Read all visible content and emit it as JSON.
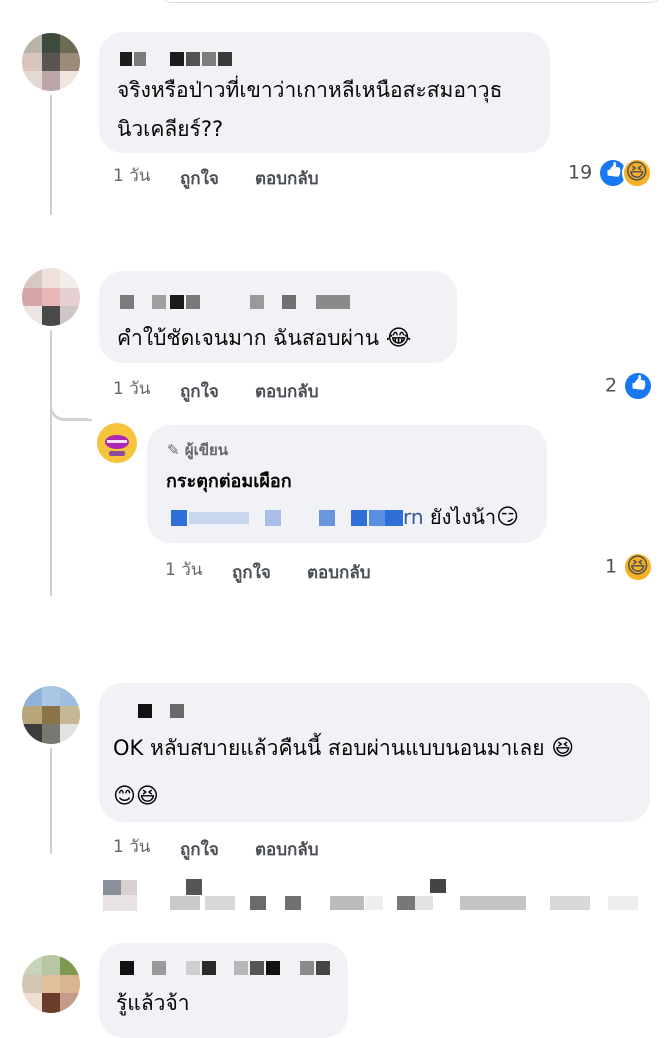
{
  "comments": [
    {
      "text_line1": "จริงหรือป่าวที่เขาว่าเกาหลีเหนือสะสมอาวุธ",
      "text_line2": "นิวเคลียร์??",
      "time": "1 วัน",
      "like_label": "ถูกใจ",
      "reply_label": "ตอบกลับ",
      "reaction_count": "19",
      "reaction_icons": [
        "like-icon",
        "haha-icon"
      ]
    },
    {
      "text": "คำใบ้ชัดเจนมาก ฉันสอบผ่าน",
      "text_emoji": "😂",
      "time": "1 วัน",
      "like_label": "ถูกใจ",
      "reply_label": "ตอบกลับ",
      "reaction_count": "2",
      "reaction_icons": [
        "like-icon"
      ],
      "reply": {
        "badge": "ผู้เขียน",
        "author": "กระตุกต่อมเผือก",
        "link_fragment": "rn",
        "text": "ยังไงน้า",
        "text_emoji": "😏",
        "time": "1 วัน",
        "like_label": "ถูกใจ",
        "reply_label": "ตอบกลับ",
        "reaction_count": "1",
        "reaction_icons": [
          "haha-icon"
        ]
      }
    },
    {
      "text_line1": "OK หลับสบายแล้วคืนนี้ สอบผ่านแบบนอนมาเลย",
      "text_line1_emoji": "😆",
      "text_line2_emoji": "😊😆",
      "time": "1 วัน",
      "like_label": "ถูกใจ",
      "reply_label": "ตอบกลับ"
    },
    {
      "text": "รู้แล้วจ้า"
    }
  ],
  "colors": {
    "bubble": "#f0f2f5",
    "meta": "#65676b",
    "like_blue": "#1877f2",
    "haha_yellow": "#f7b125",
    "link_blue": "#385898"
  }
}
